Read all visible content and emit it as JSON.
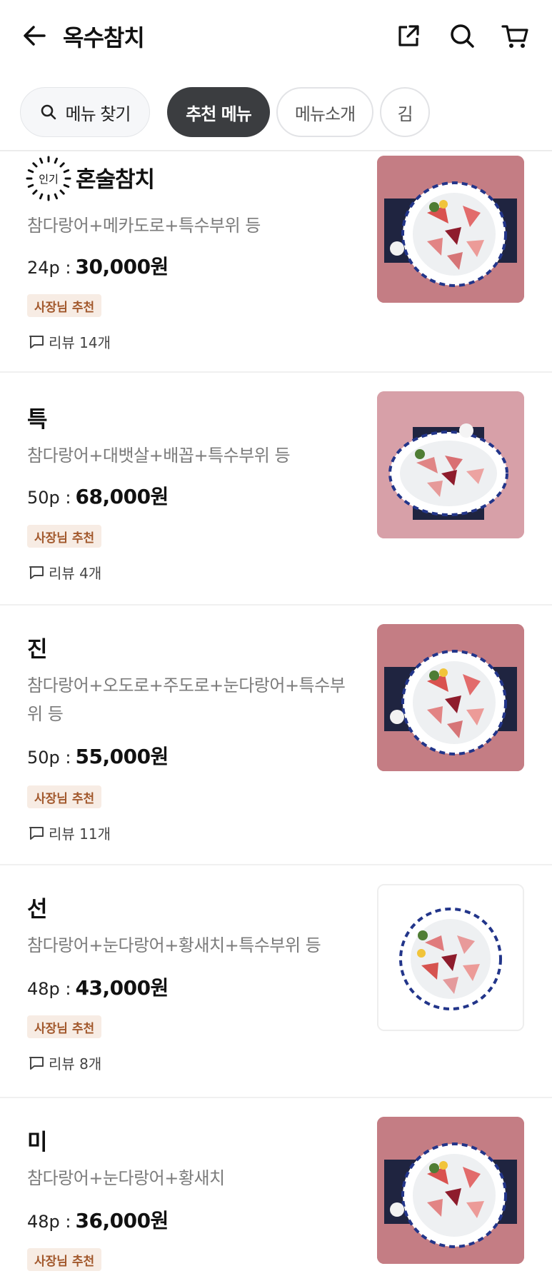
{
  "header": {
    "title": "옥수참치"
  },
  "tabs": {
    "search_label": "메뉴 찾기",
    "recommended": "추천 메뉴",
    "intro": "메뉴소개",
    "kim": "김"
  },
  "badges": {
    "popular": "인기",
    "owner_pick": "사장님 추천"
  },
  "menu_items": [
    {
      "name": "혼술참치",
      "desc": "참다랑어+메카도로+특수부위 등",
      "pieces": "24p :",
      "price": "30,000원",
      "review": "리뷰 14개"
    },
    {
      "name": "특",
      "desc": "참다랑어+대뱃살+배꼽+특수부위 등",
      "pieces": "50p :",
      "price": "68,000원",
      "review": "리뷰 4개"
    },
    {
      "name": "진",
      "desc": "참다랑어+오도로+주도로+눈다랑어+특수부위 등",
      "pieces": "50p :",
      "price": "55,000원",
      "review": "리뷰 11개"
    },
    {
      "name": "선",
      "desc": "참다랑어+눈다랑어+황새치+특수부위 등",
      "pieces": "48p :",
      "price": "43,000원",
      "review": "리뷰 8개"
    },
    {
      "name": "미",
      "desc": "참다랑어+눈다랑어+황새치",
      "pieces": "48p :",
      "price": "36,000원",
      "review": ""
    }
  ],
  "colors": {
    "active_chip": "#3b3d40",
    "owner_badge_bg": "#f7ece4",
    "owner_badge_text": "#a2582c",
    "photo_bg": "#c47d84"
  },
  "icons": [
    "back-arrow-icon",
    "share-icon",
    "search-icon",
    "cart-icon",
    "comment-icon",
    "popular-badge-icon"
  ]
}
